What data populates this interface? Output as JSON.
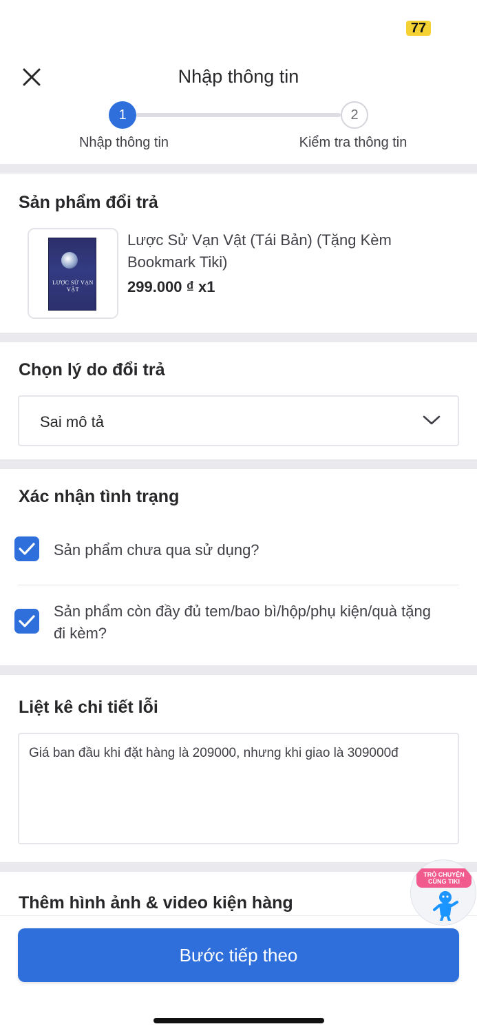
{
  "status_bar": {
    "badge": "77"
  },
  "header": {
    "title": "Nhập thông tin",
    "close_icon": "close-icon"
  },
  "stepper": {
    "steps": [
      {
        "number": "1",
        "label": "Nhập thông tin",
        "active": true
      },
      {
        "number": "2",
        "label": "Kiểm tra thông tin",
        "active": false
      }
    ]
  },
  "product_section": {
    "title": "Sản phẩm đổi trả",
    "product": {
      "name": "Lược Sử Vạn Vật (Tái Bản) (Tặng Kèm Bookmark Tiki)",
      "price": "299.000 ₫ x1",
      "cover_title": "LƯỢC SỬ VẠN VẬT"
    }
  },
  "reason_section": {
    "title": "Chọn lý do đổi trả",
    "selected": "Sai mô tả",
    "icon": "chevron-down-icon"
  },
  "condition_section": {
    "title": "Xác nhận tình trạng",
    "items": [
      {
        "label": "Sản phẩm chưa qua sử dụng?",
        "checked": true
      },
      {
        "label": "Sản phẩm còn đầy đủ tem/bao bì/hộp/phụ kiện/quà tặng đi kèm?",
        "checked": true
      }
    ]
  },
  "error_section": {
    "title": "Liệt kê chi tiết lỗi",
    "value": "Giá ban đầu khi đặt hàng là 209000, nhưng khi giao là 309000đ"
  },
  "media_section": {
    "title": "Thêm hình ảnh & video kiện hàng"
  },
  "chat": {
    "label": "TRÒ CHUYỆN CÙNG TIKI"
  },
  "footer": {
    "next_label": "Bước tiếp theo"
  },
  "colors": {
    "primary": "#2f6fdb",
    "badge": "#f5d234",
    "chat_tag": "#f05a8c"
  }
}
